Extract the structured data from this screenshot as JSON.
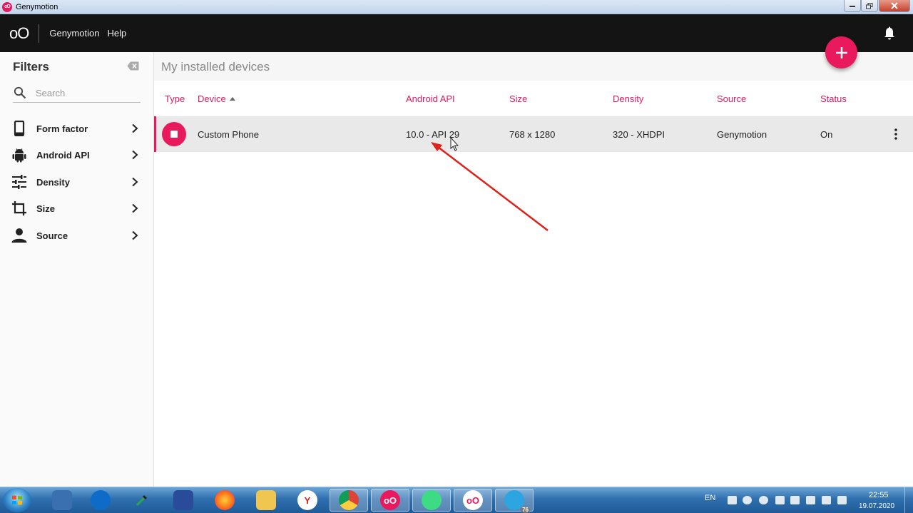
{
  "window": {
    "title": "Genymotion"
  },
  "header": {
    "logo": "oO",
    "menu": [
      {
        "label": "Genymotion"
      },
      {
        "label": "Help"
      }
    ]
  },
  "sidebar": {
    "title": "Filters",
    "search": {
      "placeholder": "Search",
      "value": ""
    },
    "filters": [
      {
        "label": "Form factor",
        "icon": "phone-icon"
      },
      {
        "label": "Android API",
        "icon": "android-icon"
      },
      {
        "label": "Density",
        "icon": "sliders-icon"
      },
      {
        "label": "Size",
        "icon": "crop-icon"
      },
      {
        "label": "Source",
        "icon": "person-icon"
      }
    ]
  },
  "main": {
    "title": "My installed devices",
    "columns": [
      "Type",
      "Device",
      "Android API",
      "Size",
      "Density",
      "Source",
      "Status"
    ],
    "sort_column": "Device",
    "devices": [
      {
        "name": "Custom Phone",
        "android_api": "10.0 - API 29",
        "size": "768 x 1280",
        "density": "320 - XHDPI",
        "source": "Genymotion",
        "status": "On"
      }
    ]
  },
  "taskbar": {
    "language": "EN",
    "time": "22:55",
    "date": "19.07.2020",
    "telegram_badge": "76"
  },
  "colors": {
    "accent": "#e8195c",
    "header_bg": "#141414",
    "column_header": "#d81b60"
  }
}
